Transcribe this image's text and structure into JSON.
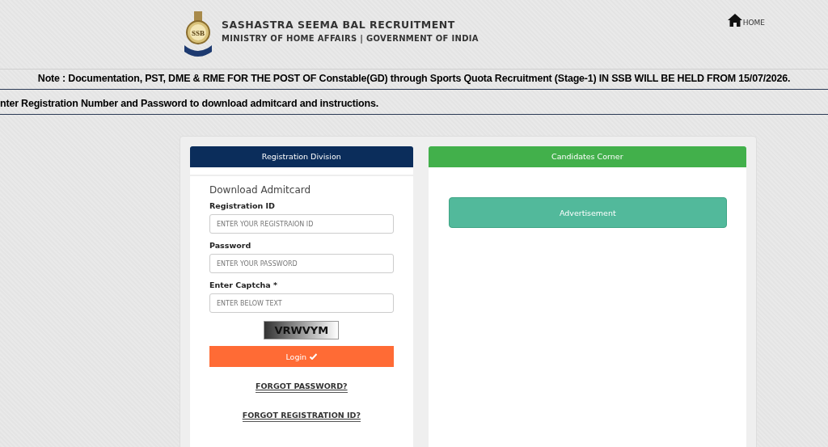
{
  "header": {
    "title": "SASHASTRA SEEMA BAL RECRUITMENT",
    "subtitle": "MINISTRY OF HOME AFFAIRS | GOVERNMENT OF INDIA",
    "logo_text": "SSB",
    "nav": [
      {
        "label": "HOME",
        "kind": "home"
      }
    ]
  },
  "note": "Note : Documentation, PST, DME & RME FOR THE POST OF Constable(GD) through Sports Quota Recruitment (Stage-1) IN SSB WILL BE HELD FROM 15/07/2026.",
  "instruction": "nter Registration Number and Password to download admitcard and instructions.",
  "registration": {
    "title": "Registration Division",
    "form_title": "Download Admitcard",
    "fields": [
      {
        "label": "Registration ID",
        "placeholder": "ENTER YOUR REGISTRAION ID"
      },
      {
        "label": "Password",
        "placeholder": "ENTER YOUR PASSWORD"
      },
      {
        "label": "Enter Captcha *",
        "placeholder": "ENTER BELOW TEXT"
      }
    ],
    "captcha": "VRWVYM",
    "login": "Login",
    "links": [
      "FORGOT PASSWORD?",
      "FORGOT REGISTRATION ID?"
    ]
  },
  "candidates": {
    "title": "Candidates Corner",
    "buttons": [
      "Advertisement"
    ]
  }
}
